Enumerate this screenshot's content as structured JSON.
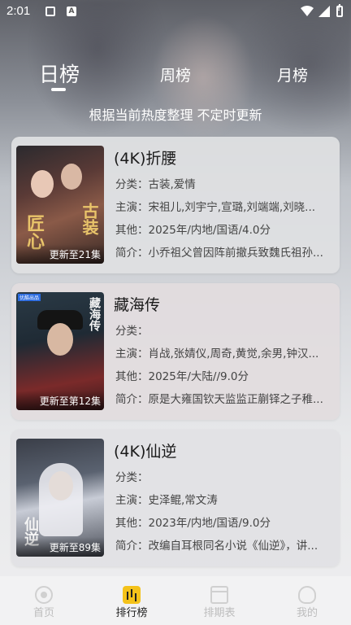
{
  "status_bar": {
    "time": "2:01",
    "a_glyph": "A"
  },
  "tabs": {
    "day": "日榜",
    "week": "周榜",
    "month": "月榜",
    "active": "day"
  },
  "subtitle": "根据当前热度整理 不定时更新",
  "items": [
    {
      "title": "(4K)折腰",
      "category": "分类：古装,爱情",
      "cast": "主演：宋祖儿,刘宇宁,宣璐,刘端端,刘晓...",
      "other": "其他：2025年/内地/国语/4.0分",
      "intro": "简介：小乔祖父曾因阵前撤兵致魏氏祖孙...",
      "update": "更新至21集",
      "poster_text": [
        "古装",
        "匠心"
      ]
    },
    {
      "title": "藏海传",
      "category": "分类：",
      "cast": "主演：肖战,张婧仪,周奇,黄觉,余男,钟汉...",
      "other": "其他：2025年/大陆//9.0分",
      "intro": "简介：原是大雍国钦天监监正蒯铎之子稚...",
      "update": "更新至第12集",
      "poster_text": [
        "藏海传"
      ],
      "poster_badge": "优酷出品"
    },
    {
      "title": "(4K)仙逆",
      "category": "分类：",
      "cast": "主演：史泽鲲,常文涛",
      "other": "其他：2023年/内地/国语/9.0分",
      "intro": "简介：改编自耳根同名小说《仙逆》，讲...",
      "update": "更新至89集",
      "poster_text": [
        "仙逆"
      ]
    }
  ],
  "nav": {
    "home": "首页",
    "rank": "排行榜",
    "schedule": "排期表",
    "me": "我的",
    "active": "rank"
  },
  "colors": {
    "accent": "#f4c21a",
    "nav_inactive": "#bdbdbd"
  }
}
